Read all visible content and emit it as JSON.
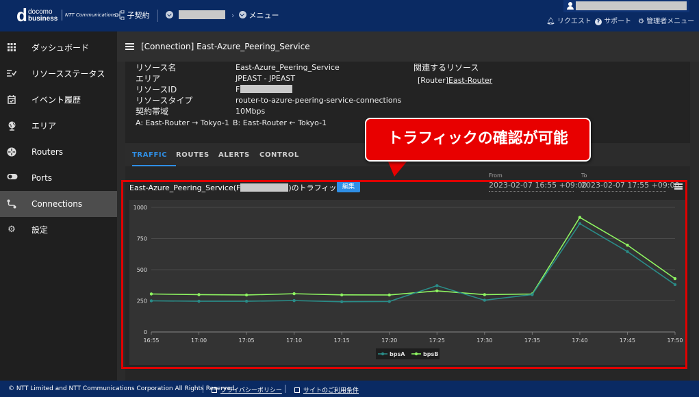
{
  "header": {
    "logo_top": "docomo",
    "logo_bottom": "business",
    "ntt": "NTT Communications",
    "contract": "子契約",
    "menu": "メニュー",
    "links": [
      "リクエスト",
      "サポート",
      "管理者メニュー"
    ]
  },
  "sidebar": {
    "items": [
      {
        "label": "ダッシュボード",
        "icon": "grid-icon"
      },
      {
        "label": "リソースステータス",
        "icon": "list-check-icon"
      },
      {
        "label": "イベント履歴",
        "icon": "calendar-check-icon"
      },
      {
        "label": "エリア",
        "icon": "globe-pin-icon"
      },
      {
        "label": "Routers",
        "icon": "router-icon"
      },
      {
        "label": "Ports",
        "icon": "toggle-icon"
      },
      {
        "label": "Connections",
        "icon": "connection-icon"
      },
      {
        "label": "設定",
        "icon": "gear-icon"
      }
    ],
    "active": "Connections"
  },
  "page": {
    "title": "[Connection] East-Azure_Peering_Service"
  },
  "info": {
    "labels": [
      "リソース名",
      "エリア",
      "リソースID",
      "リソースタイプ",
      "契約帯域"
    ],
    "values": [
      "East-Azure_Peering_Service",
      "JPEAST - JPEAST",
      "F",
      "router-to-azure-peering-service-connections",
      "10Mbps"
    ],
    "endpoint_a": "A: East-Router → Tokyo-1",
    "endpoint_b": "B: East-Router ← Tokyo-1",
    "related_title": "関連するリソース",
    "related_type": "[Router]",
    "related_link": "East-Router"
  },
  "tabs": [
    "TRAFFIC",
    "ROUTES",
    "ALERTS",
    "CONTROL"
  ],
  "callout": "トラフィックの確認が可能",
  "traffic": {
    "title_prefix": "East-Azure_Peering_Service(F",
    "title_suffix": ")のトラフィック",
    "edit": "編集",
    "from_label": "From",
    "from_value": "2023-02-07 16:55 +09:00",
    "to_label": "To",
    "to_value": "2023-02-07 17:55 +09:00"
  },
  "chart_data": {
    "type": "line",
    "x": [
      "16:55",
      "17:00",
      "17:05",
      "17:10",
      "17:15",
      "17:20",
      "17:25",
      "17:30",
      "17:35",
      "17:40",
      "17:45",
      "17:50"
    ],
    "ylim": [
      0,
      1000
    ],
    "yticks": [
      0,
      250,
      500,
      750,
      1000
    ],
    "grid": true,
    "legend_position": "bottom",
    "series": [
      {
        "name": "bpsA",
        "color": "#2a8c88",
        "values": [
          250,
          247,
          247,
          252,
          243,
          245,
          372,
          255,
          300,
          870,
          645,
          380
        ]
      },
      {
        "name": "bpsB",
        "color": "#8ef561",
        "values": [
          305,
          300,
          297,
          307,
          298,
          297,
          330,
          300,
          305,
          920,
          697,
          428
        ]
      }
    ]
  },
  "footer": {
    "copyright": "© NTT Limited and NTT Communications Corporation All Rights Reserved.",
    "privacy": "プライバシーポリシー",
    "terms": "サイトのご利用条件"
  }
}
